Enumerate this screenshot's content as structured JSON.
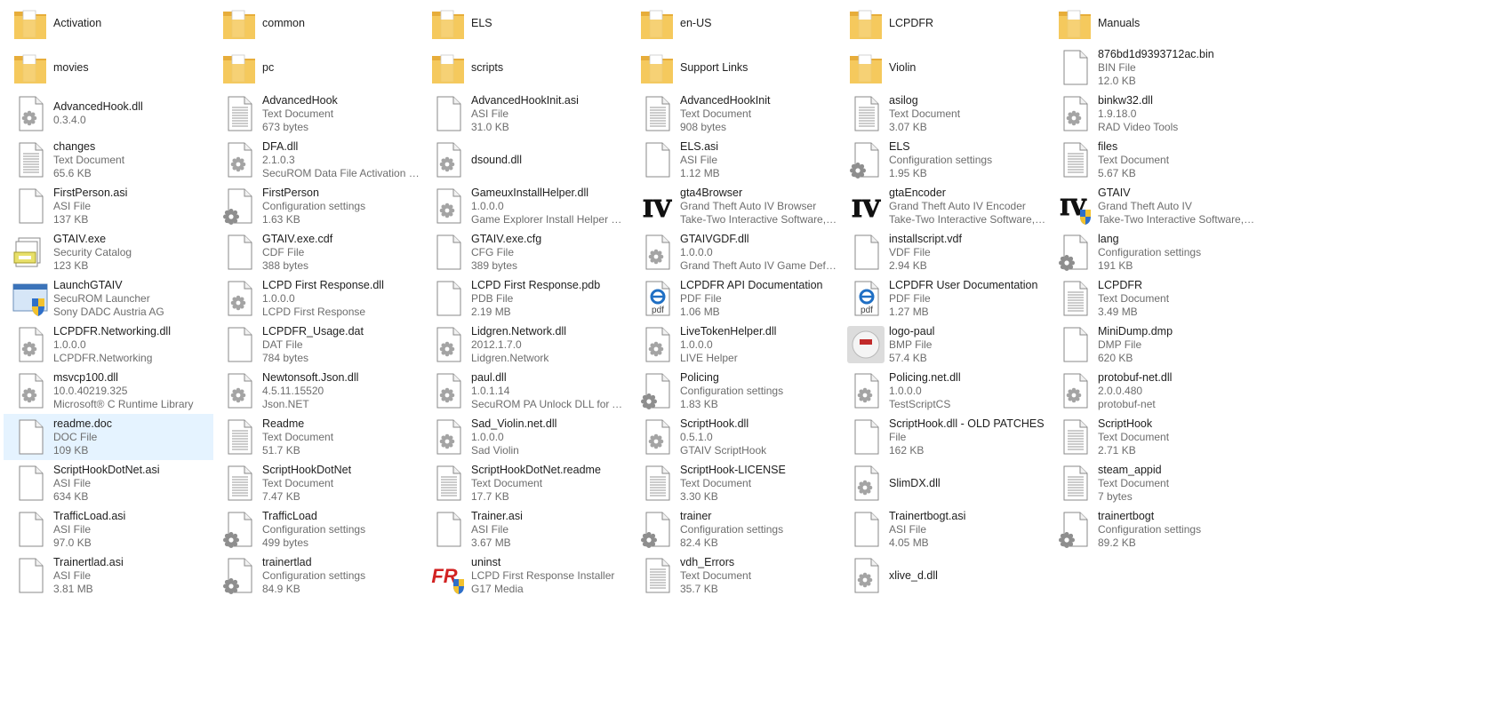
{
  "items": [
    {
      "name": "Activation",
      "icon": "folder-icon"
    },
    {
      "name": "common",
      "icon": "folder-icon"
    },
    {
      "name": "ELS",
      "icon": "folder-icon"
    },
    {
      "name": "en-US",
      "icon": "folder-icon"
    },
    {
      "name": "LCPDFR",
      "icon": "folder-icon"
    },
    {
      "name": "Manuals",
      "icon": "folder-icon"
    },
    {
      "name": "movies",
      "icon": "folder-icon"
    },
    {
      "name": "pc",
      "icon": "folder-icon"
    },
    {
      "name": "scripts",
      "icon": "folder-icon"
    },
    {
      "name": "Support Links",
      "icon": "folder-icon"
    },
    {
      "name": "Violin",
      "icon": "folder-icon"
    },
    {
      "name": "876bd1d9393712ac.bin",
      "type": "BIN File",
      "detail": "12.0 KB",
      "icon": "blank-file-icon"
    },
    {
      "name": "AdvancedHook.dll",
      "type": "0.3.4.0",
      "icon": "dll-file-icon"
    },
    {
      "name": "AdvancedHook",
      "type": "Text Document",
      "detail": "673 bytes",
      "icon": "text-file-icon"
    },
    {
      "name": "AdvancedHookInit.asi",
      "type": "ASI File",
      "detail": "31.0 KB",
      "icon": "blank-file-icon"
    },
    {
      "name": "AdvancedHookInit",
      "type": "Text Document",
      "detail": "908 bytes",
      "icon": "text-file-icon"
    },
    {
      "name": "asilog",
      "type": "Text Document",
      "detail": "3.07 KB",
      "icon": "text-file-icon"
    },
    {
      "name": "binkw32.dll",
      "type": "1.9.18.0",
      "detail": "RAD Video Tools",
      "icon": "dll-file-icon"
    },
    {
      "name": "changes",
      "type": "Text Document",
      "detail": "65.6 KB",
      "icon": "text-file-icon"
    },
    {
      "name": "DFA.dll",
      "type": "2.1.0.3",
      "detail": "SecuROM Data File Activation Lib...",
      "icon": "dll-file-icon"
    },
    {
      "name": "dsound.dll",
      "icon": "dll-file-icon"
    },
    {
      "name": "ELS.asi",
      "type": "ASI File",
      "detail": "1.12 MB",
      "icon": "blank-file-icon"
    },
    {
      "name": "ELS",
      "type": "Configuration settings",
      "detail": "1.95 KB",
      "icon": "config-file-icon"
    },
    {
      "name": "files",
      "type": "Text Document",
      "detail": "5.67 KB",
      "icon": "text-file-icon"
    },
    {
      "name": "FirstPerson.asi",
      "type": "ASI File",
      "detail": "137 KB",
      "icon": "blank-file-icon"
    },
    {
      "name": "FirstPerson",
      "type": "Configuration settings",
      "detail": "1.63 KB",
      "icon": "config-file-icon"
    },
    {
      "name": "GameuxInstallHelper.dll",
      "type": "1.0.0.0",
      "detail": "Game Explorer Install Helper DLL",
      "icon": "dll-file-icon"
    },
    {
      "name": "gta4Browser",
      "type": "Grand Theft Auto IV Browser",
      "detail": "Take-Two Interactive Software, Inc.",
      "icon": "gta-iv-icon"
    },
    {
      "name": "gtaEncoder",
      "type": "Grand Theft Auto IV Encoder",
      "detail": "Take-Two Interactive Software, Inc.",
      "icon": "gta-iv-icon"
    },
    {
      "name": "GTAIV",
      "type": "Grand Theft Auto IV",
      "detail": "Take-Two Interactive Software, Inc.",
      "icon": "gta-iv-shield-icon"
    },
    {
      "name": "GTAIV.exe",
      "type": "Security Catalog",
      "detail": "123 KB",
      "icon": "security-catalog-icon"
    },
    {
      "name": "GTAIV.exe.cdf",
      "type": "CDF File",
      "detail": "388 bytes",
      "icon": "blank-file-icon"
    },
    {
      "name": "GTAIV.exe.cfg",
      "type": "CFG File",
      "detail": "389 bytes",
      "icon": "blank-file-icon"
    },
    {
      "name": "GTAIVGDF.dll",
      "type": "1.0.0.0",
      "detail": "Grand Theft Auto IV Game Definit...",
      "icon": "dll-file-icon"
    },
    {
      "name": "installscript.vdf",
      "type": "VDF File",
      "detail": "2.94 KB",
      "icon": "blank-file-icon"
    },
    {
      "name": "lang",
      "type": "Configuration settings",
      "detail": "191 KB",
      "icon": "config-file-icon"
    },
    {
      "name": "LaunchGTAIV",
      "type": "SecuROM Launcher",
      "detail": "Sony DADC Austria AG",
      "icon": "shield-app-icon"
    },
    {
      "name": "LCPD First Response.dll",
      "type": "1.0.0.0",
      "detail": "LCPD First Response",
      "icon": "dll-file-icon"
    },
    {
      "name": "LCPD First Response.pdb",
      "type": "PDB File",
      "detail": "2.19 MB",
      "icon": "blank-file-icon"
    },
    {
      "name": "LCPDFR API Documentation",
      "type": "PDF File",
      "detail": "1.06 MB",
      "icon": "pdf-file-icon"
    },
    {
      "name": "LCPDFR User Documentation",
      "type": "PDF File",
      "detail": "1.27 MB",
      "icon": "pdf-file-icon"
    },
    {
      "name": "LCPDFR",
      "type": "Text Document",
      "detail": "3.49 MB",
      "icon": "text-file-icon"
    },
    {
      "name": "LCPDFR.Networking.dll",
      "type": "1.0.0.0",
      "detail": "LCPDFR.Networking",
      "icon": "dll-file-icon"
    },
    {
      "name": "LCPDFR_Usage.dat",
      "type": "DAT File",
      "detail": "784 bytes",
      "icon": "blank-file-icon"
    },
    {
      "name": "Lidgren.Network.dll",
      "type": "2012.1.7.0",
      "detail": "Lidgren.Network",
      "icon": "dll-file-icon"
    },
    {
      "name": "LiveTokenHelper.dll",
      "type": "1.0.0.0",
      "detail": "LIVE Helper",
      "icon": "dll-file-icon"
    },
    {
      "name": "logo-paul",
      "type": "BMP File",
      "detail": "57.4 KB",
      "icon": "bmp-image-icon"
    },
    {
      "name": "MiniDump.dmp",
      "type": "DMP File",
      "detail": "620 KB",
      "icon": "blank-file-icon"
    },
    {
      "name": "msvcp100.dll",
      "type": "10.0.40219.325",
      "detail": "Microsoft® C Runtime Library",
      "icon": "dll-file-icon"
    },
    {
      "name": "Newtonsoft.Json.dll",
      "type": "4.5.11.15520",
      "detail": "Json.NET",
      "icon": "dll-file-icon"
    },
    {
      "name": "paul.dll",
      "type": "1.0.1.14",
      "detail": "SecuROM PA Unlock DLL for Acti...",
      "icon": "dll-file-icon"
    },
    {
      "name": "Policing",
      "type": "Configuration settings",
      "detail": "1.83 KB",
      "icon": "config-file-icon"
    },
    {
      "name": "Policing.net.dll",
      "type": "1.0.0.0",
      "detail": "TestScriptCS",
      "icon": "dll-file-icon"
    },
    {
      "name": "protobuf-net.dll",
      "type": "2.0.0.480",
      "detail": "protobuf-net",
      "icon": "dll-file-icon"
    },
    {
      "name": "readme.doc",
      "type": "DOC File",
      "detail": "109 KB",
      "icon": "blank-file-icon",
      "selected": true
    },
    {
      "name": "Readme",
      "type": "Text Document",
      "detail": "51.7 KB",
      "icon": "text-file-icon"
    },
    {
      "name": "Sad_Violin.net.dll",
      "type": "1.0.0.0",
      "detail": "Sad Violin",
      "icon": "dll-file-icon"
    },
    {
      "name": "ScriptHook.dll",
      "type": "0.5.1.0",
      "detail": "GTAIV ScriptHook",
      "icon": "dll-file-icon"
    },
    {
      "name": "ScriptHook.dll - OLD PATCHES",
      "type": "File",
      "detail": "162 KB",
      "icon": "blank-file-icon"
    },
    {
      "name": "ScriptHook",
      "type": "Text Document",
      "detail": "2.71 KB",
      "icon": "text-file-icon"
    },
    {
      "name": "ScriptHookDotNet.asi",
      "type": "ASI File",
      "detail": "634 KB",
      "icon": "blank-file-icon"
    },
    {
      "name": "ScriptHookDotNet",
      "type": "Text Document",
      "detail": "7.47 KB",
      "icon": "text-file-icon"
    },
    {
      "name": "ScriptHookDotNet.readme",
      "type": "Text Document",
      "detail": "17.7 KB",
      "icon": "text-file-icon"
    },
    {
      "name": "ScriptHook-LICENSE",
      "type": "Text Document",
      "detail": "3.30 KB",
      "icon": "text-file-icon"
    },
    {
      "name": "SlimDX.dll",
      "icon": "dll-file-icon"
    },
    {
      "name": "steam_appid",
      "type": "Text Document",
      "detail": "7 bytes",
      "icon": "text-file-icon"
    },
    {
      "name": "TrafficLoad.asi",
      "type": "ASI File",
      "detail": "97.0 KB",
      "icon": "blank-file-icon"
    },
    {
      "name": "TrafficLoad",
      "type": "Configuration settings",
      "detail": "499 bytes",
      "icon": "config-file-icon"
    },
    {
      "name": "Trainer.asi",
      "type": "ASI File",
      "detail": "3.67 MB",
      "icon": "blank-file-icon"
    },
    {
      "name": "trainer",
      "type": "Configuration settings",
      "detail": "82.4 KB",
      "icon": "config-file-icon"
    },
    {
      "name": "Trainertbogt.asi",
      "type": "ASI File",
      "detail": "4.05 MB",
      "icon": "blank-file-icon"
    },
    {
      "name": "trainertbogt",
      "type": "Configuration settings",
      "detail": "89.2 KB",
      "icon": "config-file-icon"
    },
    {
      "name": "Trainertlad.asi",
      "type": "ASI File",
      "detail": "3.81 MB",
      "icon": "blank-file-icon"
    },
    {
      "name": "trainertlad",
      "type": "Configuration settings",
      "detail": "84.9 KB",
      "icon": "config-file-icon"
    },
    {
      "name": "uninst",
      "type": "LCPD First Response Installer",
      "detail": "G17 Media",
      "icon": "fr-installer-icon"
    },
    {
      "name": "vdh_Errors",
      "type": "Text Document",
      "detail": "35.7 KB",
      "icon": "text-file-icon"
    },
    {
      "name": "xlive_d.dll",
      "icon": "dll-file-icon"
    }
  ],
  "colors": {
    "folder": "#f5c95d",
    "folder_back": "#e7ad3a",
    "selection": "#e5f3ff",
    "secondary_text": "#6d6d6d"
  }
}
